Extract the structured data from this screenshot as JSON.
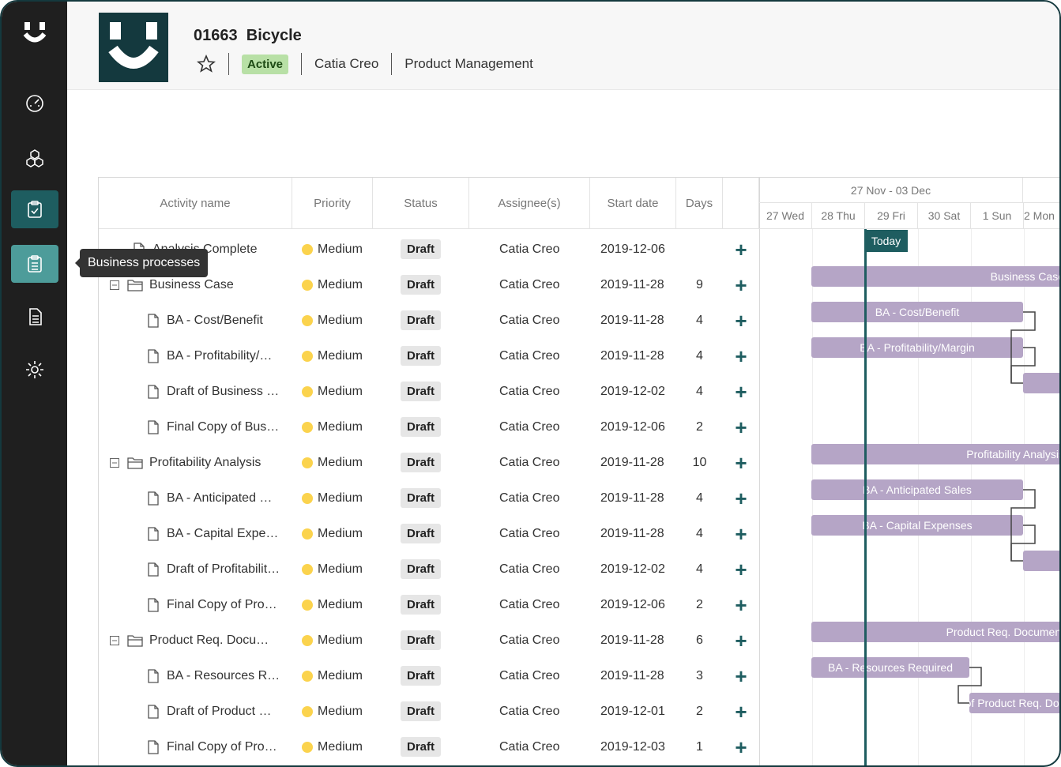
{
  "tooltip": "Business processes",
  "header": {
    "project_id": "01663",
    "project_name": "Bicycle",
    "status": "Active",
    "owner": "Catia Creo",
    "department": "Product Management"
  },
  "table": {
    "columns": [
      "Activity name",
      "Priority",
      "Status",
      "Assignee(s)",
      "Start date",
      "Days"
    ],
    "rows": [
      {
        "name": "Analysis Complete",
        "type": "doc",
        "level": 1,
        "priority": "Medium",
        "status": "Draft",
        "assignee": "Catia Creo",
        "start": "2019-12-06",
        "days": ""
      },
      {
        "name": "Business Case",
        "type": "folder",
        "level": 0,
        "priority": "Medium",
        "status": "Draft",
        "assignee": "Catia Creo",
        "start": "2019-11-28",
        "days": "9"
      },
      {
        "name": "BA - Cost/Benefit",
        "type": "doc",
        "level": 2,
        "priority": "Medium",
        "status": "Draft",
        "assignee": "Catia Creo",
        "start": "2019-11-28",
        "days": "4"
      },
      {
        "name": "BA - Profitability/…",
        "type": "doc",
        "level": 2,
        "priority": "Medium",
        "status": "Draft",
        "assignee": "Catia Creo",
        "start": "2019-11-28",
        "days": "4"
      },
      {
        "name": "Draft of Business …",
        "type": "doc",
        "level": 2,
        "priority": "Medium",
        "status": "Draft",
        "assignee": "Catia Creo",
        "start": "2019-12-02",
        "days": "4"
      },
      {
        "name": "Final Copy of Bus…",
        "type": "doc",
        "level": 2,
        "priority": "Medium",
        "status": "Draft",
        "assignee": "Catia Creo",
        "start": "2019-12-06",
        "days": "2"
      },
      {
        "name": "Profitability Analysis",
        "type": "folder",
        "level": 0,
        "priority": "Medium",
        "status": "Draft",
        "assignee": "Catia Creo",
        "start": "2019-11-28",
        "days": "10"
      },
      {
        "name": "BA - Anticipated …",
        "type": "doc",
        "level": 2,
        "priority": "Medium",
        "status": "Draft",
        "assignee": "Catia Creo",
        "start": "2019-11-28",
        "days": "4"
      },
      {
        "name": "BA - Capital Expe…",
        "type": "doc",
        "level": 2,
        "priority": "Medium",
        "status": "Draft",
        "assignee": "Catia Creo",
        "start": "2019-11-28",
        "days": "4"
      },
      {
        "name": "Draft of Profitabilit…",
        "type": "doc",
        "level": 2,
        "priority": "Medium",
        "status": "Draft",
        "assignee": "Catia Creo",
        "start": "2019-12-02",
        "days": "4"
      },
      {
        "name": "Final Copy of Pro…",
        "type": "doc",
        "level": 2,
        "priority": "Medium",
        "status": "Draft",
        "assignee": "Catia Creo",
        "start": "2019-12-06",
        "days": "2"
      },
      {
        "name": "Product Req. Docu…",
        "type": "folder",
        "level": 0,
        "priority": "Medium",
        "status": "Draft",
        "assignee": "Catia Creo",
        "start": "2019-11-28",
        "days": "6"
      },
      {
        "name": "BA - Resources R…",
        "type": "doc",
        "level": 2,
        "priority": "Medium",
        "status": "Draft",
        "assignee": "Catia Creo",
        "start": "2019-11-28",
        "days": "3"
      },
      {
        "name": "Draft of Product …",
        "type": "doc",
        "level": 2,
        "priority": "Medium",
        "status": "Draft",
        "assignee": "Catia Creo",
        "start": "2019-12-01",
        "days": "2"
      },
      {
        "name": "Final Copy of Pro…",
        "type": "doc",
        "level": 2,
        "priority": "Medium",
        "status": "Draft",
        "assignee": "Catia Creo",
        "start": "2019-12-03",
        "days": "1"
      }
    ]
  },
  "gantt": {
    "week": "27 Nov - 03 Dec",
    "days": [
      "27 Wed",
      "28 Thu",
      "29 Fri",
      "30 Sat",
      "1 Sun",
      "2 Mon"
    ],
    "today_label": "Today",
    "bars": [
      {
        "row": 1,
        "label": "Business Case"
      },
      {
        "row": 2,
        "label": "BA - Cost/Benefit"
      },
      {
        "row": 3,
        "label": "BA - Profitability/Margin"
      },
      {
        "row": 4,
        "label": ""
      },
      {
        "row": 6,
        "label": "Profitability Analysis"
      },
      {
        "row": 7,
        "label": "BA - Anticipated Sales"
      },
      {
        "row": 8,
        "label": "BA - Capital Expenses"
      },
      {
        "row": 9,
        "label": ""
      },
      {
        "row": 11,
        "label": "Product Req. Document"
      },
      {
        "row": 12,
        "label": "BA - Resources Required"
      },
      {
        "row": 13,
        "label": "Draft of Product Req. Document"
      }
    ]
  },
  "colors": {
    "sidebar": "#1f1f1f",
    "accent": "#1e5d60",
    "bar": "#b5a5c6",
    "active_badge": "#b8e0a6",
    "priority_medium": "#fbd34d"
  }
}
